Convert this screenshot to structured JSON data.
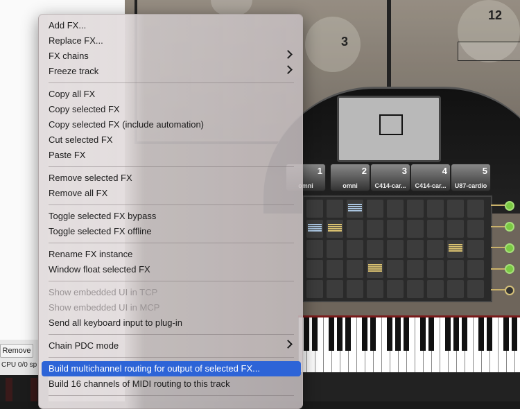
{
  "host": {
    "remove_button": "Remove",
    "cpu_text": "CPU 0/0 sp"
  },
  "plugin": {
    "mic_numbers": {
      "mic3": "3",
      "mic12": "12"
    },
    "mic_slots": [
      {
        "num": "1",
        "label": "omni"
      },
      {
        "num": "2",
        "label": "omni"
      },
      {
        "num": "3",
        "label": "C414-car..."
      },
      {
        "num": "4",
        "label": "C414-car..."
      },
      {
        "num": "5",
        "label": "U87-cardio"
      }
    ],
    "led_states": [
      "on",
      "on",
      "on",
      "on",
      "off"
    ]
  },
  "menu": {
    "items": [
      {
        "label": "Add FX...",
        "submenu": false,
        "state": "normal"
      },
      {
        "label": "Replace FX...",
        "submenu": false,
        "state": "normal"
      },
      {
        "label": "FX chains",
        "submenu": true,
        "state": "normal"
      },
      {
        "label": "Freeze track",
        "submenu": true,
        "state": "normal"
      },
      {
        "label": "Copy all FX",
        "submenu": false,
        "state": "normal"
      },
      {
        "label": "Copy selected FX",
        "submenu": false,
        "state": "normal"
      },
      {
        "label": "Copy selected FX (include automation)",
        "submenu": false,
        "state": "normal"
      },
      {
        "label": "Cut selected FX",
        "submenu": false,
        "state": "normal"
      },
      {
        "label": "Paste FX",
        "submenu": false,
        "state": "normal"
      },
      {
        "label": "Remove selected FX",
        "submenu": false,
        "state": "normal"
      },
      {
        "label": "Remove all FX",
        "submenu": false,
        "state": "normal"
      },
      {
        "label": "Toggle selected FX bypass",
        "submenu": false,
        "state": "normal"
      },
      {
        "label": "Toggle selected FX offline",
        "submenu": false,
        "state": "normal"
      },
      {
        "label": "Rename FX instance",
        "submenu": false,
        "state": "normal"
      },
      {
        "label": "Window float selected FX",
        "submenu": false,
        "state": "normal"
      },
      {
        "label": "Show embedded UI in TCP",
        "submenu": false,
        "state": "disabled"
      },
      {
        "label": "Show embedded UI in MCP",
        "submenu": false,
        "state": "disabled"
      },
      {
        "label": "Send all keyboard input to plug-in",
        "submenu": false,
        "state": "normal"
      },
      {
        "label": "Chain PDC mode",
        "submenu": true,
        "state": "normal"
      },
      {
        "label": "Build multichannel routing for output of selected FX...",
        "submenu": false,
        "state": "selected"
      },
      {
        "label": "Build 16 channels of MIDI routing to this track",
        "submenu": false,
        "state": "normal"
      }
    ]
  },
  "colors": {
    "selection": "#2d64d7",
    "led_on": "#7ac943"
  }
}
